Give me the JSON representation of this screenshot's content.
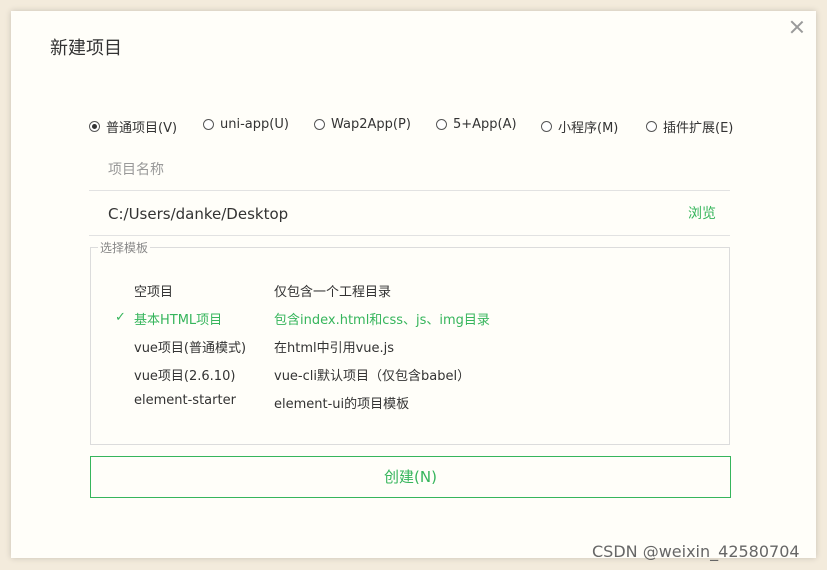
{
  "dialog": {
    "title": "新建项目",
    "close_icon": "close-icon"
  },
  "project_types": [
    {
      "label": "普通项目(V)",
      "checked": true
    },
    {
      "label": "uni-app(U)",
      "checked": false
    },
    {
      "label": "Wap2App(P)",
      "checked": false
    },
    {
      "label": "5+App(A)",
      "checked": false
    },
    {
      "label": "小程序(M)",
      "checked": false
    },
    {
      "label": "插件扩展(E)",
      "checked": false
    }
  ],
  "project_name": {
    "placeholder": "项目名称",
    "value": ""
  },
  "location": {
    "path": "C:/Users/danke/Desktop",
    "browse_label": "浏览"
  },
  "templates": {
    "legend": "选择模板",
    "items": [
      {
        "name": "空项目",
        "desc": "仅包含一个工程目录",
        "selected": false
      },
      {
        "name": "基本HTML项目",
        "desc": "包含index.html和css、js、img目录",
        "selected": true
      },
      {
        "name": "vue项目(普通模式)",
        "desc": "在html中引用vue.js",
        "selected": false
      },
      {
        "name": "vue项目(2.6.10)",
        "desc": "vue-cli默认项目（仅包含babel）",
        "selected": false
      },
      {
        "name": "element-starter",
        "desc": "element-ui的项目模板",
        "selected": false
      }
    ],
    "check_mark": "✓"
  },
  "create_button": {
    "label": "创建(N)"
  },
  "watermark": "CSDN @weixin_42580704",
  "colors": {
    "accent": "#36b55c",
    "background": "#fffef9",
    "outer": "#f3ebdc"
  }
}
